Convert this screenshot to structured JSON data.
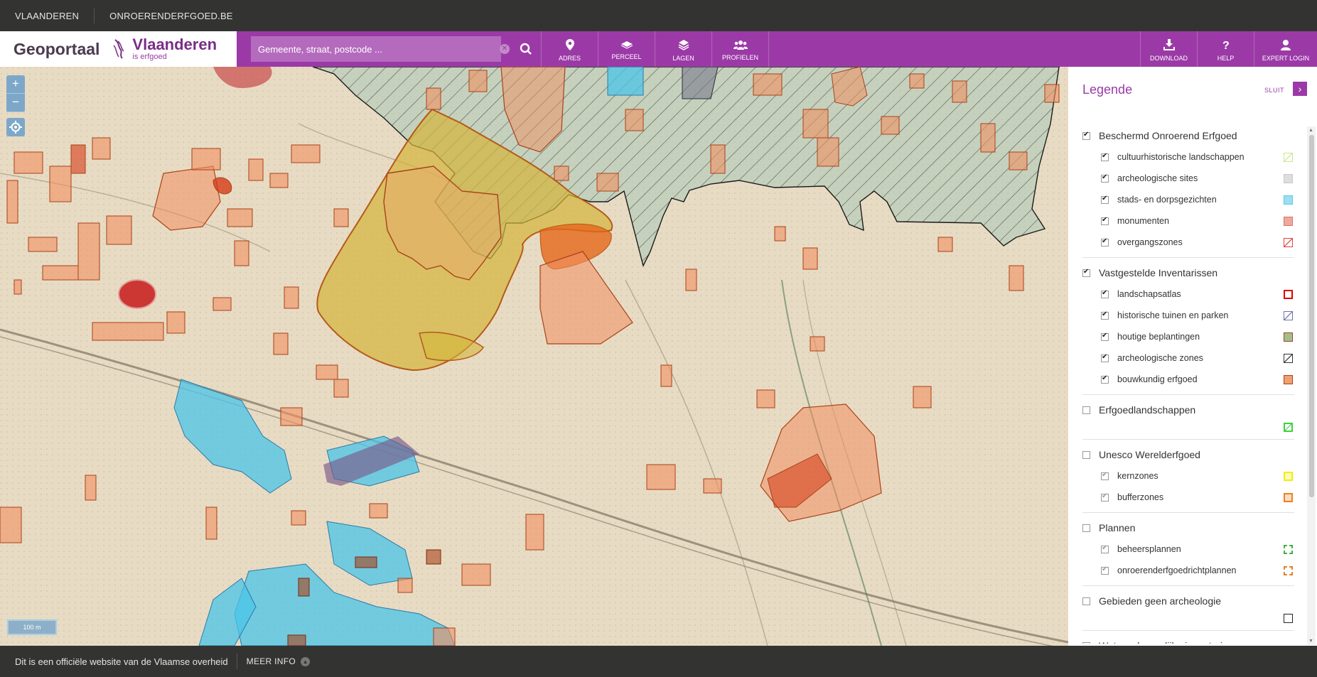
{
  "topbar": {
    "link1": "VLAANDEREN",
    "link2": "ONROERENDERFGOED.BE"
  },
  "header": {
    "app_name": "Geoportaal",
    "logo_main": "Vlaanderen",
    "logo_sub": "is erfgoed",
    "search_placeholder": "Gemeente, straat, postcode ...",
    "nav": [
      {
        "label": "ADRES",
        "icon": "map-pin-icon"
      },
      {
        "label": "PERCEEL",
        "icon": "parcel-icon"
      },
      {
        "label": "LAGEN",
        "icon": "layers-icon"
      },
      {
        "label": "PROFIELEN",
        "icon": "users-icon"
      }
    ],
    "right_nav": [
      {
        "label": "DOWNLOAD",
        "icon": "download-icon"
      },
      {
        "label": "HELP",
        "icon": "question-icon"
      },
      {
        "label": "EXPERT LOGIN",
        "icon": "user-icon"
      }
    ]
  },
  "map": {
    "zoom_in": "+",
    "zoom_out": "−",
    "scale_label": "100 m"
  },
  "legend": {
    "title": "Legende",
    "close_label": "SLUIT",
    "groups": [
      {
        "label": "Beschermd Onroerend Erfgoed",
        "checked": true,
        "items": [
          {
            "label": "cultuurhistorische landschappen",
            "checked": true,
            "swatch": "#c8e88a"
          },
          {
            "label": "archeologische sites",
            "checked": true,
            "swatch": "#c8c8c8"
          },
          {
            "label": "stads- en dorpsgezichten",
            "checked": true,
            "swatch": "#5bc8e8"
          },
          {
            "label": "monumenten",
            "checked": true,
            "swatch": "#e07060"
          },
          {
            "label": "overgangszones",
            "checked": true,
            "swatch": "#e04040"
          }
        ]
      },
      {
        "label": "Vastgestelde Inventarissen",
        "checked": true,
        "items": [
          {
            "label": "landschapsatlas",
            "checked": true,
            "swatch": "#e00000"
          },
          {
            "label": "historische tuinen en parken",
            "checked": true,
            "swatch": "#7070b0"
          },
          {
            "label": "houtige beplantingen",
            "checked": true,
            "swatch": "#a0c090"
          },
          {
            "label": "archeologische zones",
            "checked": true,
            "swatch": "#333333"
          },
          {
            "label": "bouwkundig erfgoed",
            "checked": true,
            "swatch": "#f0a070"
          }
        ]
      },
      {
        "label": "Erfgoedlandschappen",
        "checked": false,
        "items": []
      },
      {
        "label": "Unesco Werelderfgoed",
        "checked": false,
        "items": [
          {
            "label": "kernzones",
            "checked": true,
            "swatch": "#f0f000"
          },
          {
            "label": "bufferzones",
            "checked": true,
            "swatch": "#f08020"
          }
        ]
      },
      {
        "label": "Plannen",
        "checked": false,
        "items": [
          {
            "label": "beheersplannen",
            "checked": true,
            "swatch": "#40b040"
          },
          {
            "label": "onroerenderfgoedrichtplannen",
            "checked": true,
            "swatch": "#e08030"
          }
        ]
      },
      {
        "label": "Gebieden geen archeologie",
        "checked": false,
        "items": []
      },
      {
        "label": "Wetenschappelijke inventarissen",
        "checked": false,
        "items": []
      }
    ]
  },
  "footer": {
    "text": "Dit is een officiële website van de Vlaamse overheid",
    "more": "MEER INFO"
  },
  "colors": {
    "brand_purple": "#9b3aa7",
    "dark_bar": "#333332"
  }
}
